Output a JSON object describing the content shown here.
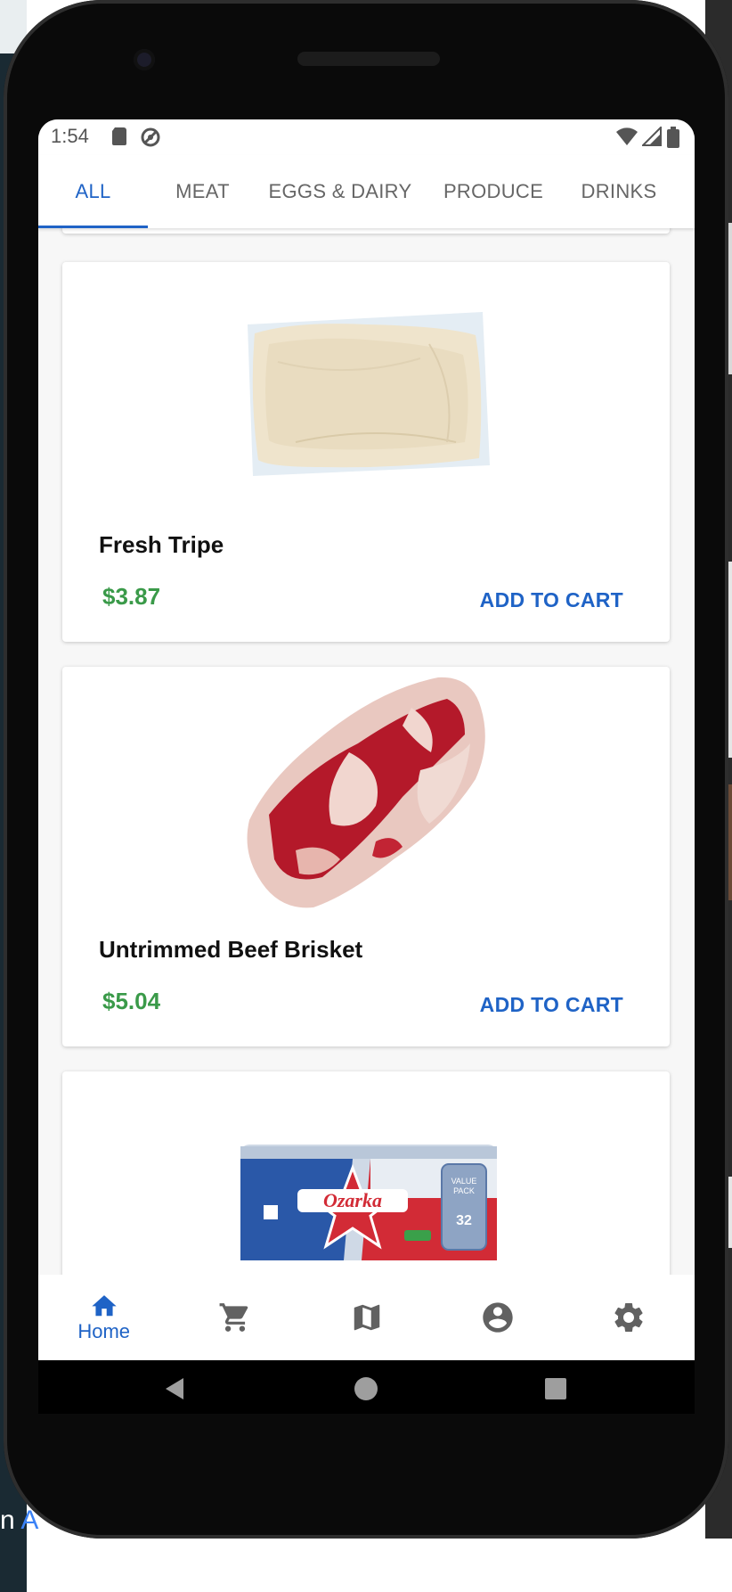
{
  "status_bar": {
    "time": "1:54"
  },
  "tabs": [
    {
      "label": "ALL",
      "active": true
    },
    {
      "label": "MEAT",
      "active": false
    },
    {
      "label": "EGGS & DAIRY",
      "active": false
    },
    {
      "label": "PRODUCE",
      "active": false
    },
    {
      "label": "DRINKS",
      "active": false
    }
  ],
  "products": [
    {
      "name": "Fresh Tripe",
      "price": "$3.87",
      "action": "ADD TO CART",
      "image": "tripe-image"
    },
    {
      "name": "Untrimmed Beef Brisket",
      "price": "$5.04",
      "action": "ADD TO CART",
      "image": "brisket-image"
    },
    {
      "name": "",
      "price": "",
      "action": "",
      "image": "ozarka-water-image",
      "image_text": {
        "brand": "Ozarka",
        "badge": "VALUE PACK",
        "count": "32"
      }
    }
  ],
  "bottom_nav": {
    "home_label": "Home",
    "items": [
      "home-icon",
      "cart-icon",
      "map-icon",
      "account-icon",
      "settings-icon"
    ],
    "active": "Home"
  },
  "colors": {
    "accent": "#1f63c6",
    "price": "#3a9a49"
  }
}
